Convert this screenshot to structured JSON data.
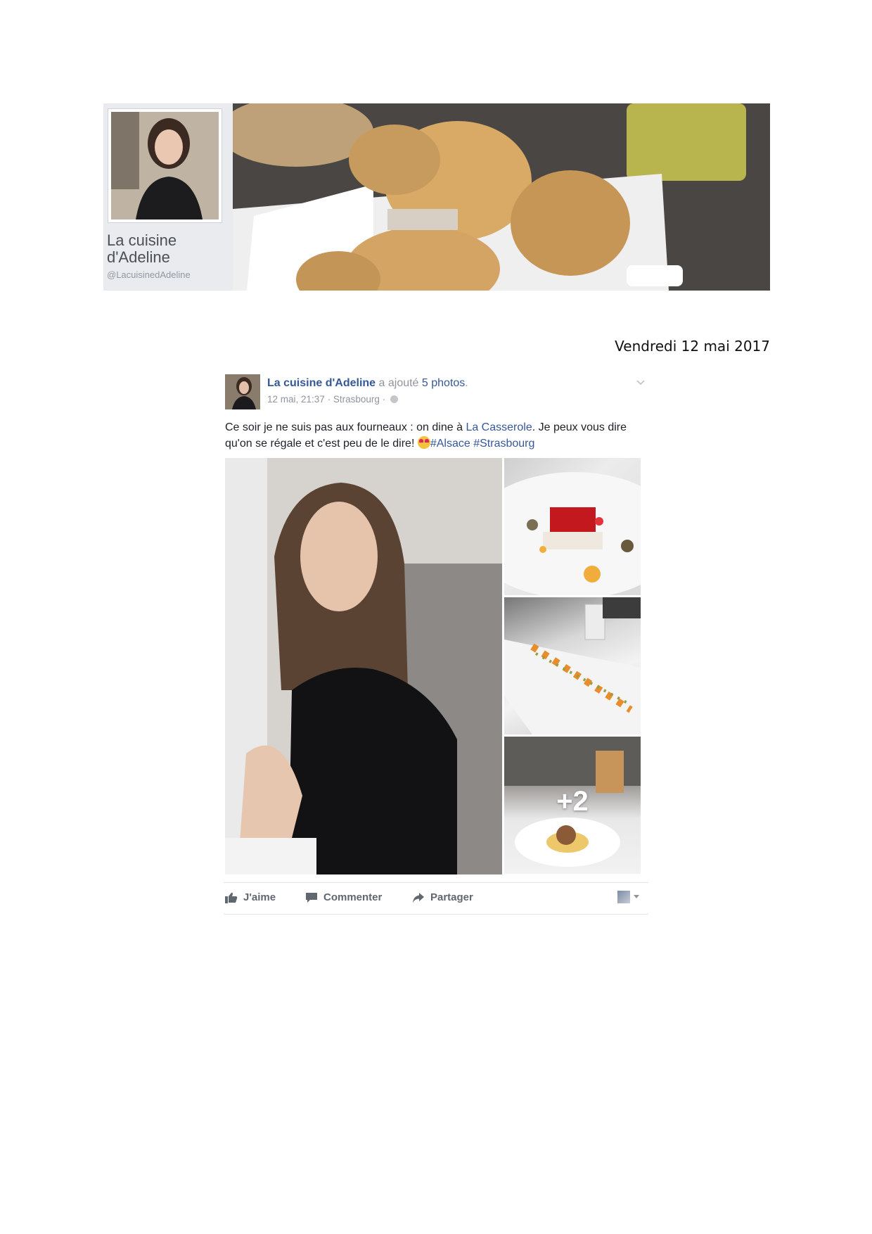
{
  "page": {
    "name": "La cuisine d'Adeline",
    "handle": "@LacuisinedAdeline"
  },
  "date_caption": "Vendredi 12 mai 2017",
  "post": {
    "author": "La cuisine d'Adeline",
    "action_text": "a ajouté",
    "photos_link": "5 photos",
    "period": ".",
    "timestamp": "12 mai, 21:37",
    "separator": "·",
    "location": "Strasbourg",
    "message_part1": "Ce soir je ne suis pas aux fourneaux : on dine à",
    "message_link": "La Casserole",
    "message_part2": ". Je peux vous dire qu'on se régale et c'est peu de le dire!",
    "hashtags": [
      "#Alsace",
      "#Strasbourg"
    ],
    "more_photos_label": "+2"
  },
  "actions": {
    "like_label": "J'aime",
    "comment_label": "Commenter",
    "share_label": "Partager"
  },
  "colors": {
    "link_blue": "#365899",
    "meta_gray": "#90949c",
    "action_gray": "#616770",
    "banner_bg": "#e9ebee"
  },
  "icons": [
    "like-icon",
    "comment-icon",
    "share-icon",
    "globe-icon",
    "chevron-down-icon"
  ]
}
